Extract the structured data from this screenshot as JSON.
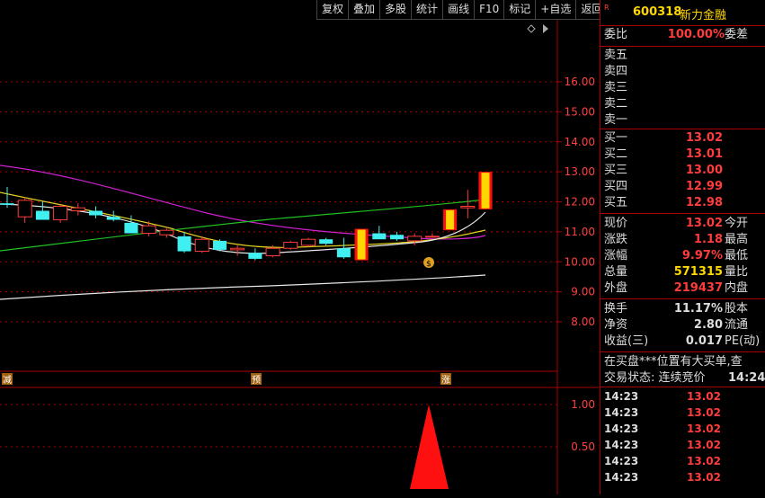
{
  "toolbar": {
    "buttons": [
      "复权",
      "叠加",
      "多股",
      "统计",
      "画线",
      "F10",
      "标记",
      "+自选",
      "返回"
    ]
  },
  "chart": {
    "price_ticks": [
      "16.00",
      "15.00",
      "14.00",
      "13.00",
      "12.00",
      "11.00",
      "10.00",
      "9.00",
      "8.00"
    ],
    "indicator_ticks": [
      "1.00",
      "0.50"
    ],
    "markers": {
      "reduce": "减",
      "forecast": "预",
      "rise": "涨"
    },
    "candles": [
      {
        "o": 11.95,
        "h": 12.5,
        "l": 11.8,
        "c": 11.9
      },
      {
        "o": 11.5,
        "h": 12.15,
        "l": 11.3,
        "c": 12.05
      },
      {
        "o": 11.7,
        "h": 12.0,
        "l": 11.45,
        "c": 11.4
      },
      {
        "o": 11.4,
        "h": 11.9,
        "l": 11.3,
        "c": 11.85
      },
      {
        "o": 11.7,
        "h": 11.95,
        "l": 11.55,
        "c": 11.8
      },
      {
        "o": 11.7,
        "h": 11.85,
        "l": 11.45,
        "c": 11.55
      },
      {
        "o": 11.5,
        "h": 11.7,
        "l": 11.35,
        "c": 11.4
      },
      {
        "o": 11.3,
        "h": 11.55,
        "l": 10.95,
        "c": 10.95
      },
      {
        "o": 10.95,
        "h": 11.35,
        "l": 10.85,
        "c": 11.2
      },
      {
        "o": 10.9,
        "h": 11.15,
        "l": 10.8,
        "c": 11.05
      },
      {
        "o": 10.85,
        "h": 11.0,
        "l": 10.3,
        "c": 10.35
      },
      {
        "o": 10.35,
        "h": 10.85,
        "l": 10.3,
        "c": 10.75
      },
      {
        "o": 10.7,
        "h": 10.75,
        "l": 10.35,
        "c": 10.4
      },
      {
        "o": 10.4,
        "h": 10.55,
        "l": 10.2,
        "c": 10.45
      },
      {
        "o": 10.3,
        "h": 10.45,
        "l": 10.05,
        "c": 10.1
      },
      {
        "o": 10.2,
        "h": 10.55,
        "l": 10.15,
        "c": 10.45
      },
      {
        "o": 10.45,
        "h": 10.7,
        "l": 10.4,
        "c": 10.65
      },
      {
        "o": 10.55,
        "h": 10.8,
        "l": 10.5,
        "c": 10.75
      },
      {
        "o": 10.75,
        "h": 10.8,
        "l": 10.55,
        "c": 10.6
      },
      {
        "o": 10.45,
        "h": 10.8,
        "l": 10.1,
        "c": 10.15
      },
      {
        "o": 10.05,
        "h": 11.1,
        "l": 10.05,
        "c": 11.1
      },
      {
        "o": 10.95,
        "h": 11.2,
        "l": 10.8,
        "c": 10.75
      },
      {
        "o": 10.9,
        "h": 11.0,
        "l": 10.7,
        "c": 10.75
      },
      {
        "o": 10.7,
        "h": 10.95,
        "l": 10.55,
        "c": 10.85
      },
      {
        "o": 10.85,
        "h": 10.95,
        "l": 10.8,
        "c": 10.85
      },
      {
        "o": 11.05,
        "h": 11.75,
        "l": 11.05,
        "c": 11.75
      },
      {
        "o": 11.8,
        "h": 12.4,
        "l": 11.45,
        "c": 11.85
      },
      {
        "o": 11.75,
        "h": 13.0,
        "l": 11.75,
        "c": 13.0
      }
    ]
  },
  "quote": {
    "code": "600318",
    "name": "新力金融",
    "r_mark": "R",
    "webi_label": "委比",
    "webi_value": "100.00%",
    "weicha_label": "委差",
    "sell": [
      "卖五",
      "卖四",
      "卖三",
      "卖二",
      "卖一"
    ],
    "buy": [
      {
        "label": "买一",
        "price": "13.02"
      },
      {
        "label": "买二",
        "price": "13.01"
      },
      {
        "label": "买三",
        "price": "13.00"
      },
      {
        "label": "买四",
        "price": "12.99"
      },
      {
        "label": "买五",
        "price": "12.98"
      }
    ],
    "stats": [
      {
        "label": "现价",
        "value": "13.02",
        "label2": "今开",
        "color": "red"
      },
      {
        "label": "涨跌",
        "value": "1.18",
        "label2": "最高",
        "color": "red"
      },
      {
        "label": "涨幅",
        "value": "9.97%",
        "label2": "最低",
        "color": "red"
      },
      {
        "label": "总量",
        "value": "571315",
        "label2": "量比",
        "color": "yel"
      },
      {
        "label": "外盘",
        "value": "219437",
        "label2": "内盘",
        "color": "red"
      }
    ],
    "stats2": [
      {
        "label": "换手",
        "value": "11.17%",
        "label2": "股本"
      },
      {
        "label": "净资",
        "value": "2.80",
        "label2": "流通"
      },
      {
        "label": "收益(三)",
        "value": "0.017",
        "label2": "PE(动)"
      }
    ],
    "notice": "在买盘***位置有大买单,查",
    "trade_status": "交易状态: 连续竞价",
    "trade_time": "14:24:",
    "ticks": [
      {
        "time": "14:23",
        "price": "13.02"
      },
      {
        "time": "14:23",
        "price": "13.02"
      },
      {
        "time": "14:23",
        "price": "13.02"
      },
      {
        "time": "14:23",
        "price": "13.02"
      },
      {
        "time": "14:23",
        "price": "13.02"
      },
      {
        "time": "14:23",
        "price": "13.02"
      }
    ]
  }
}
